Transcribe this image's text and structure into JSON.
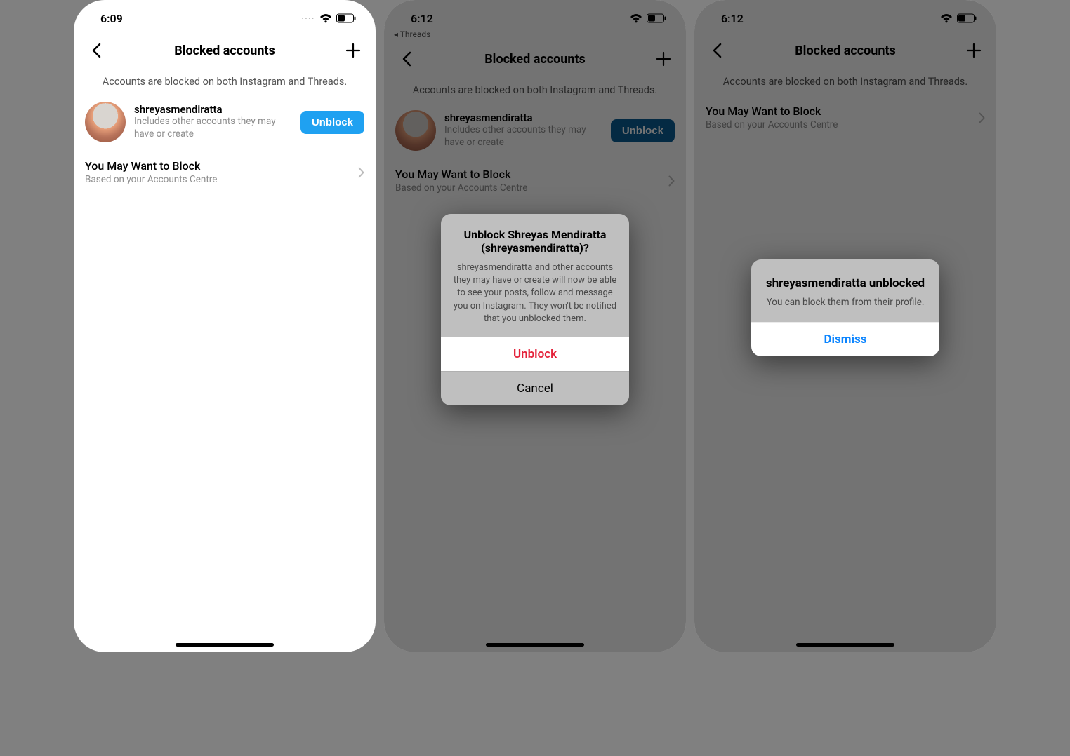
{
  "screens": [
    {
      "time": "6:09",
      "backApp": "",
      "headerTitle": "Blocked accounts",
      "subtitle": "Accounts are blocked on both Instagram and Threads.",
      "account": {
        "user": "shreyasmendiratta",
        "sub": "Includes other accounts they may have or create",
        "show": true
      },
      "unblockLabel": "Unblock",
      "suggest": {
        "title": "You May Want to Block",
        "sub": "Based on your Accounts Centre"
      }
    },
    {
      "time": "6:12",
      "backApp": "◂ Threads",
      "headerTitle": "Blocked accounts",
      "subtitle": "Accounts are blocked on both Instagram and Threads.",
      "account": {
        "user": "shreyasmendiratta",
        "sub": "Includes other accounts they may have or create",
        "show": true
      },
      "unblockLabel": "Unblock",
      "suggest": {
        "title": "You May Want to Block",
        "sub": "Based on your Accounts Centre"
      },
      "dialog": {
        "title": "Unblock Shreyas Mendiratta (shreyasmendiratta)?",
        "body": "shreyasmendiratta and other accounts they may have or create will now be able to see your posts, follow and message you on Instagram. They won't be notified that you unblocked them.",
        "confirm": "Unblock",
        "cancel": "Cancel"
      }
    },
    {
      "time": "6:12",
      "backApp": "",
      "headerTitle": "Blocked accounts",
      "subtitle": "Accounts are blocked on both Instagram and Threads.",
      "account": {
        "show": false
      },
      "suggest": {
        "title": "You May Want to Block",
        "sub": "Based on your Accounts Centre"
      },
      "dialog": {
        "title": "shreyasmendiratta unblocked",
        "body": "You can block them from their profile.",
        "dismiss": "Dismiss"
      }
    }
  ]
}
